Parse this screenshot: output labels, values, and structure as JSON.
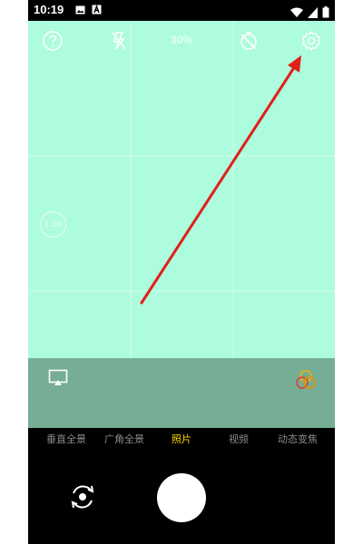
{
  "status_bar": {
    "time": "10:19",
    "icons": [
      "photo-icon",
      "a-icon",
      "wifi-icon",
      "signal-icon",
      "battery-icon"
    ]
  },
  "camera": {
    "top_icons": [
      "help-icon",
      "flash-off-icon",
      "timer-off-icon",
      "settings-icon"
    ],
    "zoom_percent": "30%",
    "zoom_badge": "1.0x",
    "modes": [
      {
        "label": "垂直全景",
        "active": false
      },
      {
        "label": "广角全景",
        "active": false
      },
      {
        "label": "照片",
        "active": true
      },
      {
        "label": "视频",
        "active": false
      },
      {
        "label": "动态变焦",
        "active": false
      }
    ],
    "bottom_icons": [
      "cast-icon",
      "filter-icon",
      "switch-camera-icon",
      "shutter-button"
    ]
  },
  "colors": {
    "viewfinder": "#adfcdd",
    "bottom_strip": "#76ad95",
    "active_mode": "#f5d600",
    "annotation_arrow": "#e0201a"
  }
}
